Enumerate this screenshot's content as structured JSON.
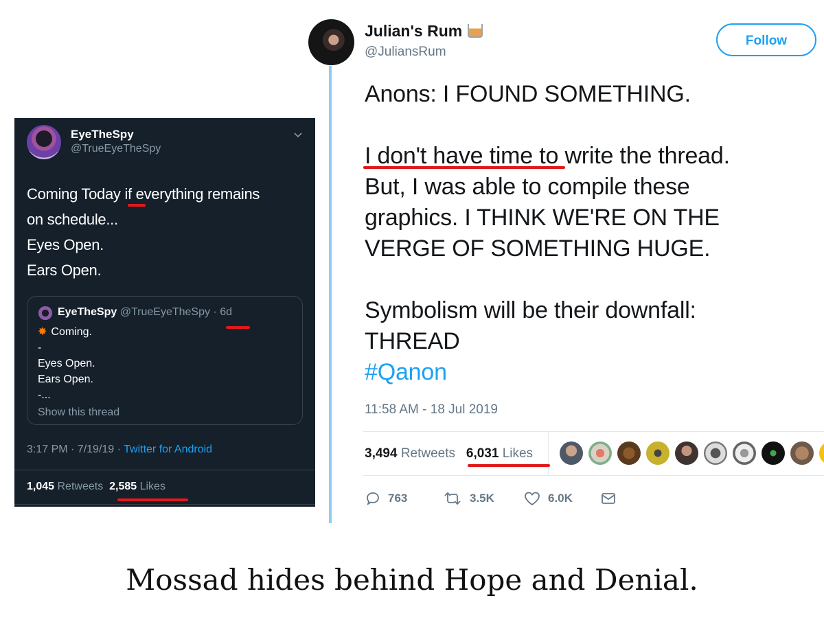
{
  "left_tweet": {
    "name": "EyeTheSpy",
    "handle": "@TrueEyeTheSpy",
    "text_lines": [
      "Coming Today if everything remains",
      "on schedule...",
      "Eyes Open.",
      "Ears Open."
    ],
    "quoted": {
      "name": "EyeTheSpy",
      "handle_time": "@TrueEyeTheSpy · 6d",
      "first_line": "Coming.",
      "lines": [
        "-",
        "Eyes Open.",
        "Ears Open.",
        "-..."
      ],
      "show_thread": "Show this thread"
    },
    "meta_time": "3:17 PM · 7/19/19 · ",
    "meta_source": "Twitter for Android",
    "retweets_count": "1,045",
    "retweets_label": "Retweets",
    "likes_count": "2,585",
    "likes_label": "Likes"
  },
  "right_tweet": {
    "name": "Julian's Rum",
    "handle": "@JuliansRum",
    "follow_label": "Follow",
    "body_lines": [
      "Anons: I FOUND SOMETHING.",
      "I don't have time to write the thread.",
      "But, I was able to compile these",
      "graphics. I THINK WE'RE ON THE",
      "VERGE OF SOMETHING HUGE.",
      "Symbolism will be their downfall:",
      "THREAD"
    ],
    "hashtag": "#Qanon",
    "timestamp": "11:58 AM - 18 Jul 2019",
    "retweets_count": "3,494",
    "retweets_label": "Retweets",
    "likes_count": "6,031",
    "likes_label": "Likes",
    "replies": "763",
    "retweets_short": "3.5K",
    "likes_short": "6.0K"
  },
  "caption": "Mossad hides behind Hope and Denial.",
  "colors": {
    "dark_bg": "#15202b",
    "twitter_blue": "#1da1f2",
    "annotation_red": "#e0191b",
    "thread_line": "#8ecdf1"
  }
}
